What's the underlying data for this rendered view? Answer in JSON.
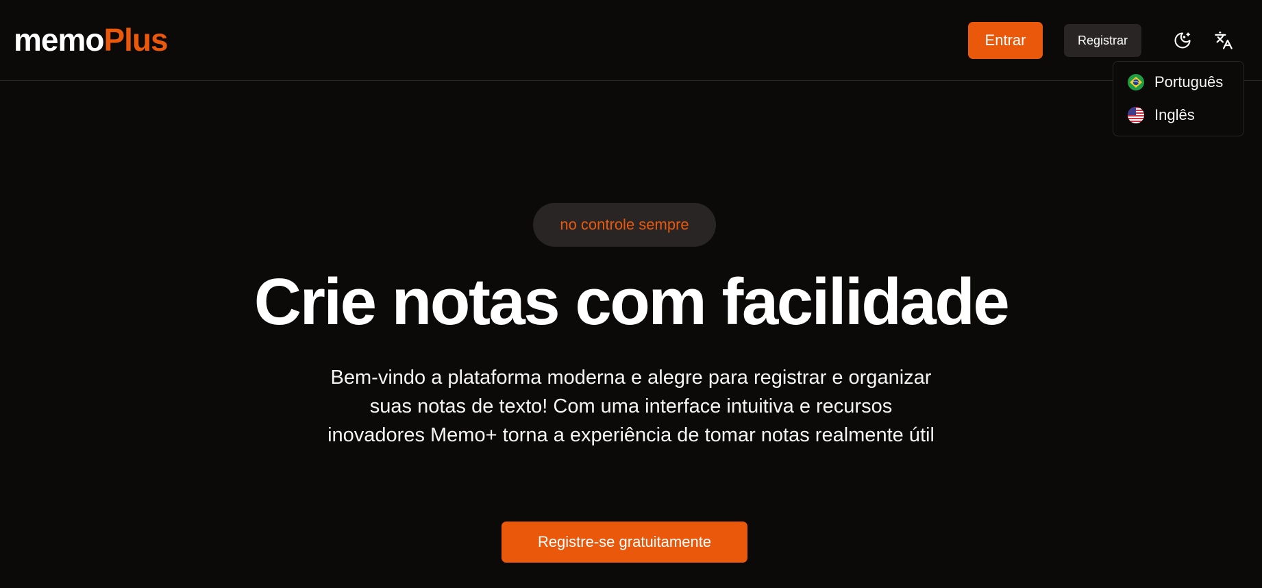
{
  "header": {
    "logo": {
      "part1": "memo",
      "part2": "Plus"
    },
    "login_label": "Entrar",
    "register_label": "Registrar",
    "theme_icon": "moon-stars-icon",
    "language_icon": "translate-icon"
  },
  "language_menu": {
    "items": [
      {
        "label": "Português",
        "icon": "brazil-flag-icon"
      },
      {
        "label": "Inglês",
        "icon": "usa-flag-icon"
      }
    ]
  },
  "hero": {
    "badge": "no controle sempre",
    "title": "Crie notas com facilidade",
    "description": "Bem-vindo a plataforma moderna e alegre para registrar e organizar suas notas de texto! Com uma interface intuitiva e recursos inovadores Memo+ torna a experiência de tomar notas realmente útil",
    "cta_label": "Registre-se gratuitamente"
  },
  "colors": {
    "background": "#0b0a09",
    "accent": "#ea580c",
    "surface": "#292524",
    "text": "#f5f5f4"
  }
}
